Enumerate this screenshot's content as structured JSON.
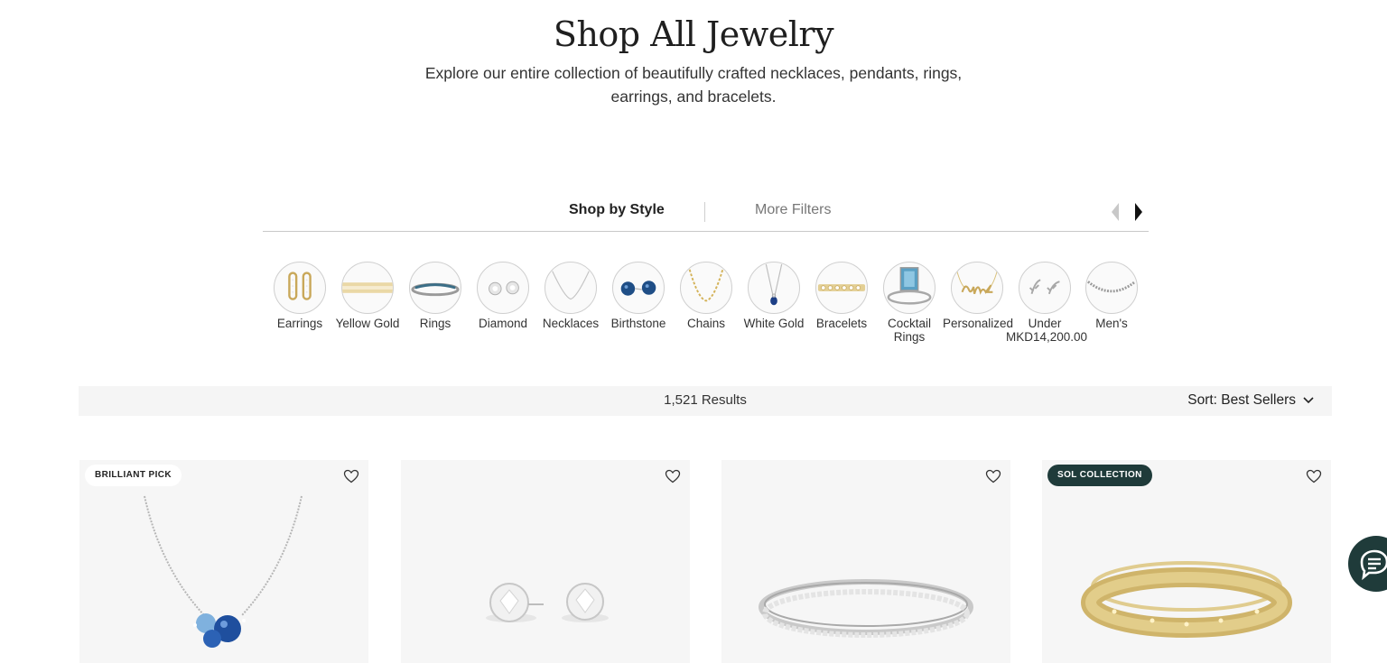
{
  "hero": {
    "title": "Shop All Jewelry",
    "subtitle": "Explore our entire collection of beautifully crafted necklaces, pendants, rings, earrings, and bracelets."
  },
  "tabs": {
    "active": "Shop by Style",
    "inactive": "More Filters"
  },
  "styles": [
    {
      "label": "Earrings",
      "icon": "hoop-earrings-icon"
    },
    {
      "label": "Yellow Gold",
      "icon": "gold-band-icon"
    },
    {
      "label": "Rings",
      "icon": "ring-icon"
    },
    {
      "label": "Diamond",
      "icon": "diamond-studs-icon"
    },
    {
      "label": "Necklaces",
      "icon": "necklace-icon"
    },
    {
      "label": "Birthstone",
      "icon": "birthstone-studs-icon"
    },
    {
      "label": "Chains",
      "icon": "chain-icon"
    },
    {
      "label": "White Gold",
      "icon": "pendant-icon"
    },
    {
      "label": "Bracelets",
      "icon": "bracelet-icon"
    },
    {
      "label": "Cocktail Rings",
      "icon": "cocktail-ring-icon"
    },
    {
      "label": "Personalized",
      "icon": "name-necklace-icon"
    },
    {
      "label": "Under MKD14,200.00",
      "icon": "leaf-earrings-icon"
    },
    {
      "label": "Men's",
      "icon": "mens-chain-icon"
    }
  ],
  "results": {
    "count": "1,521 Results",
    "sort_label": "Sort: Best Sellers"
  },
  "products": [
    {
      "badge": "BRILLIANT PICK",
      "image": "sapphire-necklace"
    },
    {
      "badge": "",
      "image": "diamond-stud-earrings"
    },
    {
      "badge": "",
      "image": "diamond-eternity-band"
    },
    {
      "badge": "SOL COLLECTION",
      "image": "gold-bangle"
    }
  ],
  "colors": {
    "accent_dark": "#1f3b3a",
    "results_bar": "#f5f5f5",
    "card_bg": "#f6f6f6"
  }
}
